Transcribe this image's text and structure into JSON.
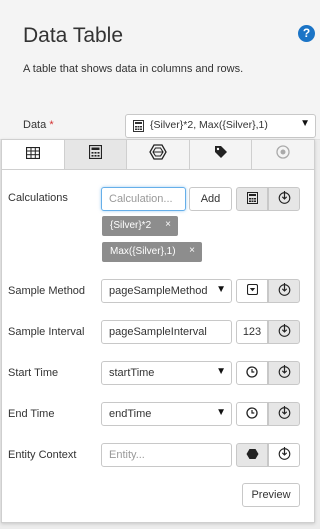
{
  "header": {
    "title": "Data Table",
    "help_glyph": "?",
    "description": "A table that shows data in columns and rows.",
    "data_label": "Data",
    "required_mark": "*",
    "data_value": "{Silver}*2, Max({Silver},1)"
  },
  "tabs": [
    {
      "icon": "table-icon"
    },
    {
      "icon": "calculator-icon"
    },
    {
      "icon": "hexagon-asset-icon"
    },
    {
      "icon": "tag-icon"
    },
    {
      "icon": "circle-dot-icon"
    }
  ],
  "calculations": {
    "label": "Calculations",
    "placeholder": "Calculation...",
    "add_label": "Add",
    "chips": [
      "{Silver}*2",
      "Max({Silver},1)"
    ],
    "chip_close": "×"
  },
  "sample_method": {
    "label": "Sample Method",
    "value": "pageSampleMethod"
  },
  "sample_interval": {
    "label": "Sample Interval",
    "value": "pageSampleInterval",
    "number_icon": "123"
  },
  "start_time": {
    "label": "Start Time",
    "value": "startTime"
  },
  "end_time": {
    "label": "End Time",
    "value": "endTime"
  },
  "entity_context": {
    "label": "Entity Context",
    "placeholder": "Entity..."
  },
  "preview_label": "Preview",
  "colors": {
    "accent": "#1b74c6",
    "chip": "#8d8d8d",
    "required": "#d32f2f"
  }
}
